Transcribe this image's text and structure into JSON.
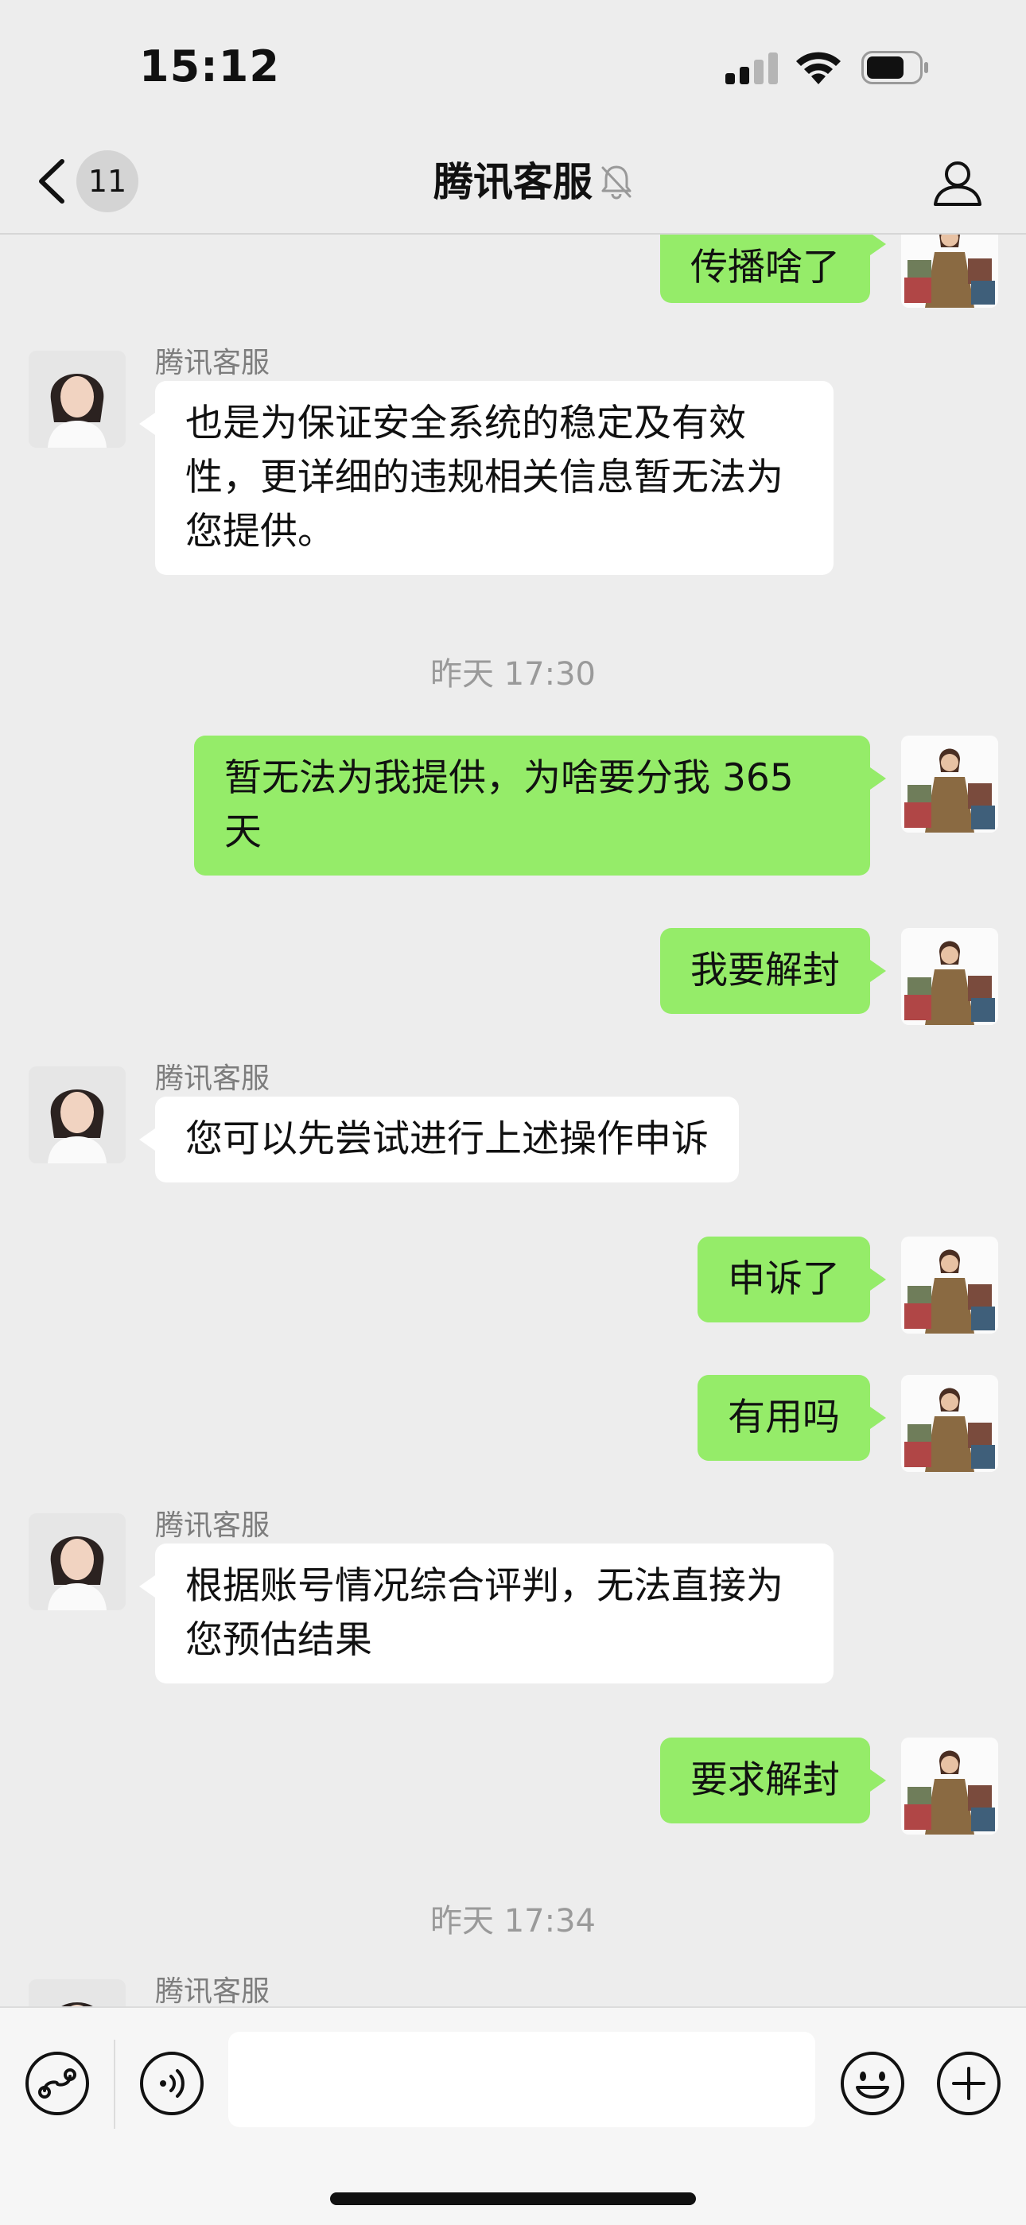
{
  "status_bar": {
    "time": "15:12"
  },
  "nav": {
    "back_count": "11",
    "title": "腾讯客服"
  },
  "messages": [
    {
      "text": "传播啥了"
    },
    {
      "sender": "腾讯客服",
      "text": "也是为保证安全系统的稳定及有效性，更详细的违规相关信息暂无法为您提供。"
    },
    {
      "text": "昨天 17:30"
    },
    {
      "text": "暂无法为我提供，为啥要分我 365 天"
    },
    {
      "text": "我要解封"
    },
    {
      "sender": "腾讯客服",
      "text": "您可以先尝试进行上述操作申诉"
    },
    {
      "text": "申诉了"
    },
    {
      "text": "有用吗"
    },
    {
      "sender": "腾讯客服",
      "text": "根据账号情况综合评判，无法直接为您预估结果"
    },
    {
      "text": "要求解封"
    },
    {
      "text": "昨天 17:34"
    },
    {
      "sender": "腾讯客服"
    }
  ],
  "input_bar": {
    "placeholder": ""
  },
  "colors": {
    "background": "#ededed",
    "outgoing_bubble": "#95ec69",
    "incoming_bubble": "#ffffff",
    "timestamp_text": "#9a9a9a"
  },
  "icons": {
    "nav": [
      "back-chevron-icon",
      "mute-bell-icon",
      "contact-person-icon"
    ],
    "input": [
      "mini-program-link-icon",
      "voice-icon",
      "emoji-icon",
      "plus-icon"
    ]
  }
}
